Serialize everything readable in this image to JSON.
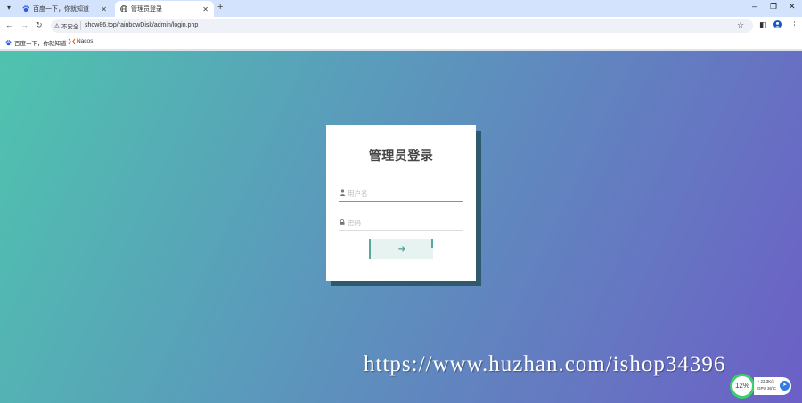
{
  "browser": {
    "tabs": [
      {
        "label": "百度一下，你就知道",
        "active": false
      },
      {
        "label": "管理员登录",
        "active": true
      }
    ],
    "address": {
      "security_label": "不安全",
      "url": "show86.top/rainbowDisk/admin/login.php"
    },
    "bookmarks": [
      {
        "label": "百度一下，你就知道"
      },
      {
        "label": "Nacos"
      }
    ]
  },
  "login": {
    "title": "管理员登录",
    "username_placeholder": "用户名",
    "username_value": "",
    "password_placeholder": "密码",
    "password_value": "",
    "submit_glyph": "➔"
  },
  "watermark": "https://www.huzhan.com/ishop34396",
  "monitor": {
    "cpu_percent": "12%",
    "net": "↑ 23.3K/s",
    "gpu": "GPU 36°C"
  },
  "colors": {
    "gradient_start": "#4fc3ae",
    "gradient_end": "#6c5fc6",
    "accent": "#5aa7a0",
    "card_shadow": "#2f5a6e"
  }
}
